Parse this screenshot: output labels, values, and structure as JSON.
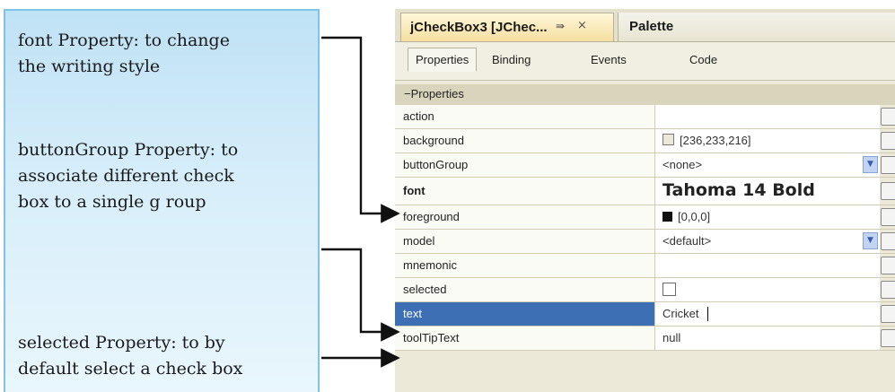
{
  "annotations": {
    "font": [
      "font Property: to change",
      "the writing style"
    ],
    "button_group": [
      "buttonGroup Property: to",
      "associate different check",
      "box to a single g roup"
    ],
    "selected": [
      "selected Property: to by",
      "default select a check box"
    ]
  },
  "ide": {
    "tab_active": "jCheckBox3 [JChec...",
    "tab_maximize_glyph": "⇛",
    "tab_close_glyph": "×",
    "tab_palette": "Palette",
    "subtabs": [
      "Properties",
      "Binding",
      "Events",
      "Code"
    ],
    "section_label": "Properties",
    "section_toggle": "−",
    "properties": [
      {
        "name": "action",
        "value": ""
      },
      {
        "name": "background",
        "value": "[236,233,216]"
      },
      {
        "name": "buttonGroup",
        "value": "<none>"
      },
      {
        "name": "font",
        "value": "Tahoma 14 Bold"
      },
      {
        "name": "foreground",
        "value": "[0,0,0]"
      },
      {
        "name": "model",
        "value": "<default>"
      },
      {
        "name": "mnemonic",
        "value": ""
      },
      {
        "name": "selected",
        "value": ""
      },
      {
        "name": "text",
        "value": "Cricket"
      },
      {
        "name": "toolTipText",
        "value": "null"
      }
    ],
    "selected_property": "text",
    "colors": {
      "selection": "#3d6fb5",
      "callout_border": "#7fc3e8",
      "arrow": "#111111"
    }
  }
}
